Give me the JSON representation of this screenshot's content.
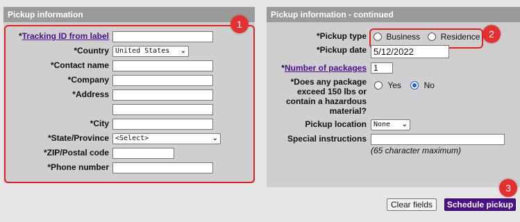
{
  "left": {
    "title": "Pickup information",
    "tracking_label": "Tracking ID from label",
    "tracking_value": "",
    "country_label": "Country",
    "country_value": "United States",
    "contact_label": "Contact name",
    "company_label": "Company",
    "address_label": "Address",
    "city_label": "City",
    "state_label": "State/Province",
    "state_value": "<Select>",
    "zip_label": "ZIP/Postal code",
    "phone_label": "Phone number",
    "required_mark": "*"
  },
  "right": {
    "title": "Pickup information - continued",
    "pickup_type_label": "*Pickup type",
    "business_label": "Business",
    "residence_label": "Residence",
    "pickup_date_label": "*Pickup date",
    "pickup_date_value": "5/12/2022",
    "num_packages_label": "Number of packages",
    "num_packages_value": "1",
    "exceed_label_1": "*Does any package",
    "exceed_label_2": "exceed 150 lbs or",
    "exceed_label_3": "contain a hazardous",
    "exceed_label_4": "material?",
    "yes_label": "Yes",
    "no_label": "No",
    "location_label": "Pickup location",
    "location_value": "None",
    "instructions_label": "Special instructions",
    "instructions_hint": "(65 character maximum)"
  },
  "buttons": {
    "clear": "Clear fields",
    "schedule": "Schedule pickup"
  },
  "badges": {
    "one": "1",
    "two": "2",
    "three": "3"
  },
  "colors": {
    "header_bg": "#9b9b9b",
    "panel_bg": "#cfcfcf",
    "link": "#4b0f8c",
    "annotation_red": "#e02020",
    "primary_button": "#4b0f8c"
  }
}
